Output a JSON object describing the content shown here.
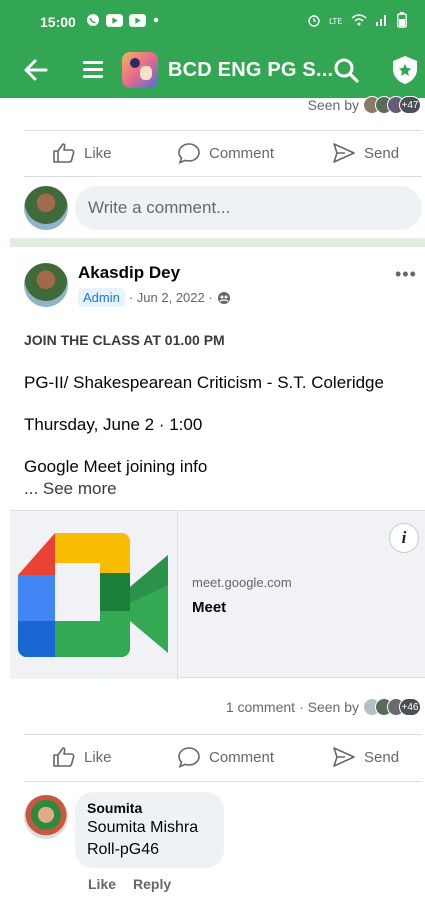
{
  "status_bar": {
    "time": "15:00",
    "left_icons": [
      "whatsapp-icon",
      "youtube-icon",
      "youtube-icon",
      "dot-icon"
    ],
    "right_icons": [
      "alarm-icon",
      "volte-icon",
      "wifi-icon",
      "signal-icon",
      "battery-icon"
    ]
  },
  "app_bar": {
    "title": "BCD ENG PG S...",
    "accent_color": "#33a653"
  },
  "previous_post": {
    "seen_label": "Seen by",
    "seen_count": "+47",
    "like_label": "Like",
    "comment_label": "Comment",
    "send_label": "Send"
  },
  "composer": {
    "placeholder": "Write a comment..."
  },
  "post": {
    "author": "Akasdip Dey",
    "badge": "Admin",
    "date": "· Jun 2, 2022 ·",
    "heading": "JOIN THE CLASS AT 01.00 PM",
    "line1": "PG-II/ Shakespearean Criticism - S.T. Coleridge",
    "line2": "Thursday, June 2 · 1:00",
    "line3": "Google Meet joining info",
    "see_more": "... See more",
    "link_domain": "meet.google.com",
    "link_title": "Meet",
    "info_label": "i",
    "comments_count": "1 comment",
    "seen_label": "· Seen by",
    "seen_count": "+46",
    "like_label": "Like",
    "comment_label": "Comment",
    "send_label": "Send"
  },
  "comment": {
    "author": "Soumita",
    "line1": "Soumita Mishra",
    "line2": "Roll-pG46",
    "like_label": "Like",
    "reply_label": "Reply"
  }
}
